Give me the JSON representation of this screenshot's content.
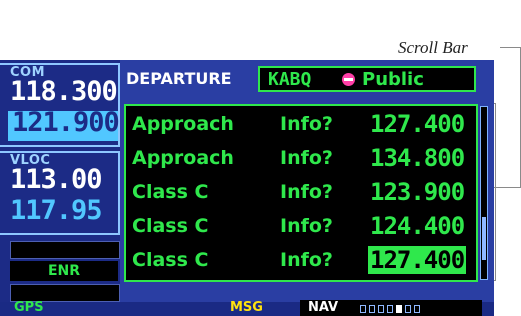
{
  "callout": {
    "label": "Scroll Bar"
  },
  "com": {
    "label": "COM",
    "active": "118.300",
    "standby": "121.900"
  },
  "vloc": {
    "label": "VLOC",
    "active": "113.00",
    "standby": "117.95"
  },
  "mode": {
    "label": "ENR"
  },
  "header": {
    "title": "DEPARTURE",
    "airport": "KABQ",
    "type": "Public"
  },
  "rows": [
    {
      "name": "Approach",
      "info": "Info?",
      "freq": "127.400",
      "selected": false
    },
    {
      "name": "Approach",
      "info": "Info?",
      "freq": "134.800",
      "selected": false
    },
    {
      "name": "Class C",
      "info": "Info?",
      "freq": "123.900",
      "selected": false
    },
    {
      "name": "Class C",
      "info": "Info?",
      "freq": "124.400",
      "selected": false
    },
    {
      "name": "Class C",
      "info": "Info?",
      "freq": "127.400",
      "selected": true
    }
  ],
  "scroll": {
    "position_fraction": 0.85,
    "thumb_fraction": 0.25
  },
  "status": {
    "gps": "GPS",
    "msg": "MSG",
    "nav": "NAV",
    "page_count": 7,
    "active_page": 4
  },
  "colors": {
    "green": "#2fe84c",
    "cyan": "#51c7ff",
    "blue": "#2a3ea3",
    "msg_yellow": "#ffe20f"
  }
}
